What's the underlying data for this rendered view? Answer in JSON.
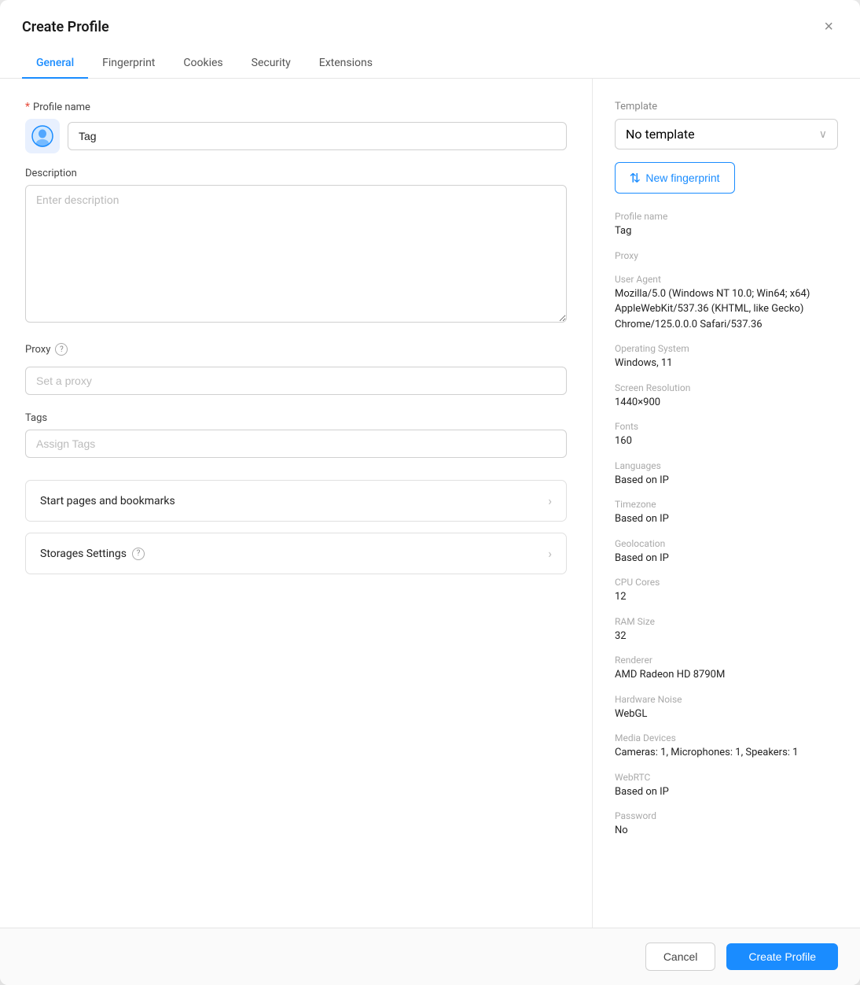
{
  "modal": {
    "title": "Create Profile",
    "close_label": "×"
  },
  "tabs": [
    {
      "id": "general",
      "label": "General",
      "active": true
    },
    {
      "id": "fingerprint",
      "label": "Fingerprint",
      "active": false
    },
    {
      "id": "cookies",
      "label": "Cookies",
      "active": false
    },
    {
      "id": "security",
      "label": "Security",
      "active": false
    },
    {
      "id": "extensions",
      "label": "Extensions",
      "active": false
    }
  ],
  "form": {
    "profile_name_label": "Profile name",
    "profile_name_required": "*",
    "profile_name_value": "Tag",
    "description_label": "Description",
    "description_placeholder": "Enter description",
    "proxy_label": "Proxy",
    "proxy_placeholder": "Set a proxy",
    "tags_label": "Tags",
    "tags_placeholder": "Assign Tags",
    "start_pages_label": "Start pages and bookmarks",
    "storage_settings_label": "Storages Settings"
  },
  "right_panel": {
    "template_label": "Template",
    "template_value": "No template",
    "new_fingerprint_label": "New fingerprint",
    "fingerprint_icon": "⇄",
    "chevron": "∨",
    "info": {
      "profile_name_key": "Profile name",
      "profile_name_val": "Tag",
      "proxy_key": "Proxy",
      "proxy_val": "",
      "user_agent_key": "User Agent",
      "user_agent_val": "Mozilla/5.0 (Windows NT 10.0; Win64; x64) AppleWebKit/537.36 (KHTML, like Gecko) Chrome/125.0.0.0 Safari/537.36",
      "os_key": "Operating System",
      "os_val": "Windows, 11",
      "screen_key": "Screen Resolution",
      "screen_val": "1440×900",
      "fonts_key": "Fonts",
      "fonts_val": "160",
      "languages_key": "Languages",
      "languages_val": "Based on IP",
      "timezone_key": "Timezone",
      "timezone_val": "Based on IP",
      "geolocation_key": "Geolocation",
      "geolocation_val": "Based on IP",
      "cpu_key": "CPU Cores",
      "cpu_val": "12",
      "ram_key": "RAM Size",
      "ram_val": "32",
      "renderer_key": "Renderer",
      "renderer_val": "AMD Radeon HD 8790M",
      "hardware_noise_key": "Hardware Noise",
      "hardware_noise_val": "WebGL",
      "media_devices_key": "Media Devices",
      "media_devices_val": "Cameras: 1, Microphones: 1, Speakers: 1",
      "webrtc_key": "WebRTC",
      "webrtc_val": "Based on IP",
      "password_key": "Password",
      "password_val": "No"
    }
  },
  "footer": {
    "cancel_label": "Cancel",
    "create_label": "Create Profile"
  }
}
